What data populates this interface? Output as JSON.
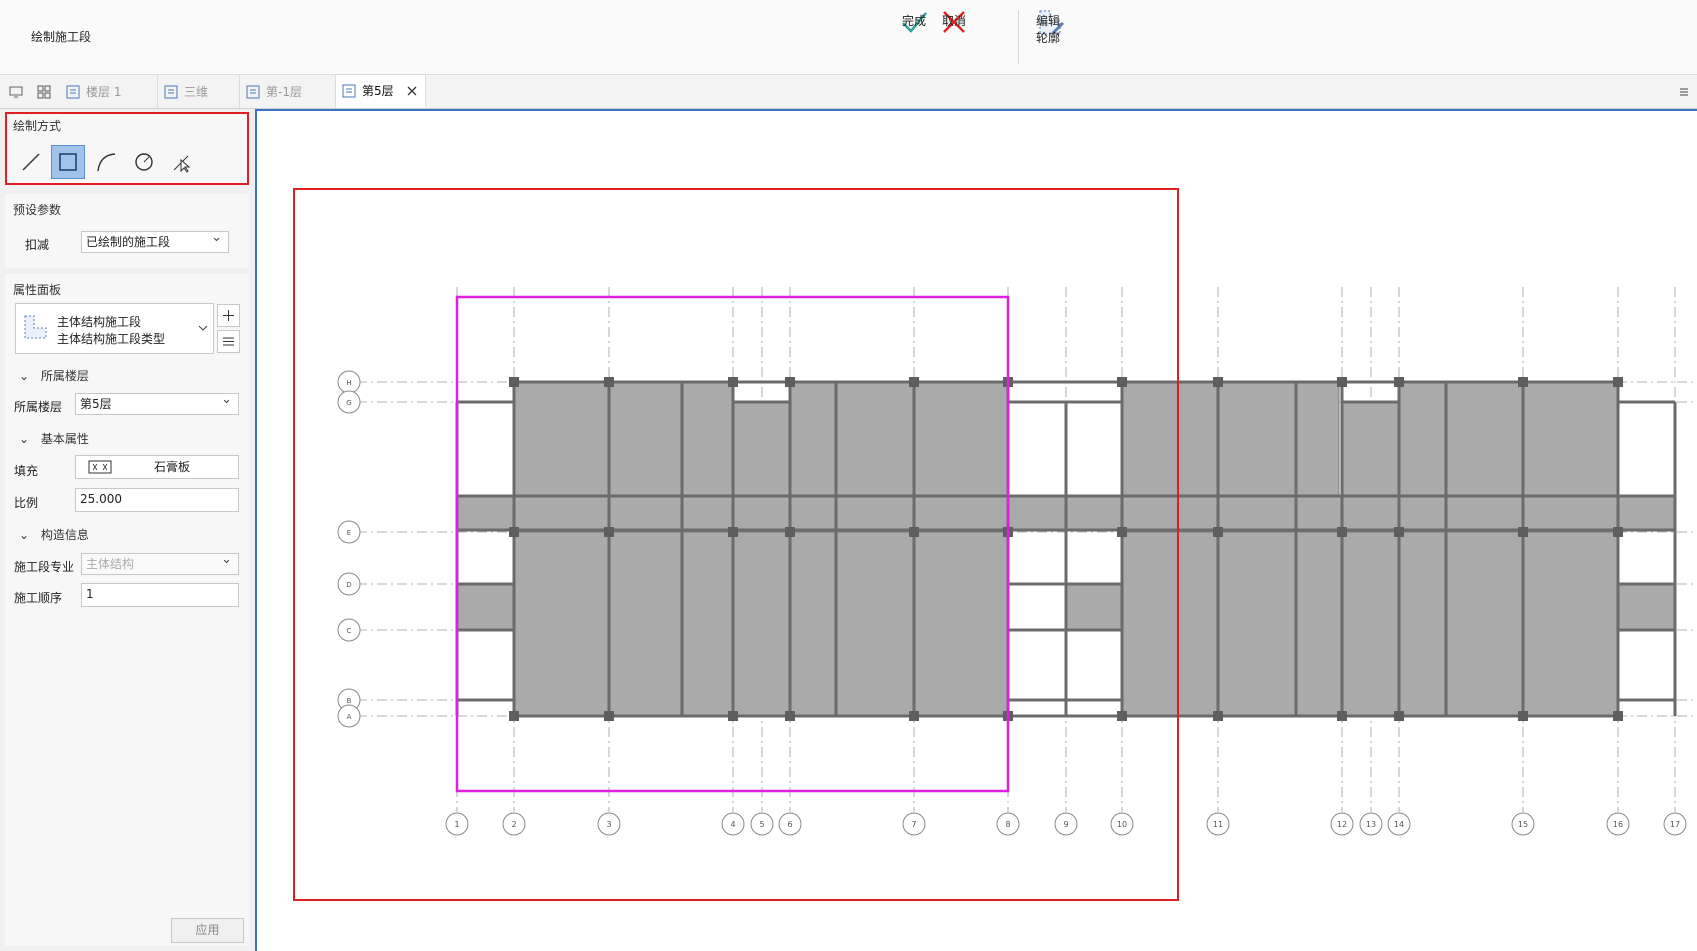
{
  "app": {
    "title": "绘制施工段"
  },
  "toolbar": {
    "finish_label": "完成",
    "cancel_label": "取消",
    "edit_outline_label": "编辑轮廓",
    "finish_color": "#2aa198",
    "cancel_color": "#e02424"
  },
  "tabs": [
    {
      "label": "楼层 1",
      "active": false
    },
    {
      "label": "三维",
      "active": false
    },
    {
      "label": "第-1层",
      "active": false
    },
    {
      "label": "第5层",
      "active": true
    }
  ],
  "panel": {
    "draw_mode": {
      "title": "绘制方式",
      "modes": [
        "line-icon",
        "rectangle-icon",
        "arc-icon",
        "circle-icon",
        "pick-icon"
      ],
      "selected": "rectangle-icon"
    },
    "preset": {
      "title": "预设参数",
      "deduct_label": "扣减",
      "deduct_value": "已绘制的施工段"
    },
    "props": {
      "title": "属性面板",
      "type_name": "主体结构施工段",
      "type_sub": "主体结构施工段类型",
      "group_floor": "所属楼层",
      "floor_label": "所属楼层",
      "floor_value": "第5层",
      "group_basic": "基本属性",
      "fill_label": "填充",
      "fill_value": "石膏板",
      "scale_label": "比例",
      "scale_value": "25.000",
      "group_construct": "构造信息",
      "specialty_label": "施工段专业",
      "specialty_value": "主体结构",
      "order_label": "施工顺序",
      "order_value": "1",
      "apply_label": "应用"
    }
  },
  "drawing": {
    "axis_numbers": [
      "1",
      "2",
      "3",
      "4",
      "5",
      "6",
      "7",
      "8",
      "9",
      "10",
      "11",
      "12",
      "13",
      "14",
      "15",
      "16",
      "17"
    ],
    "axis_letters": [
      "H",
      "G",
      "E",
      "D",
      "C",
      "B",
      "A"
    ],
    "highlight_colors": {
      "outer": "#e02020",
      "selection": "#e020e0"
    }
  }
}
